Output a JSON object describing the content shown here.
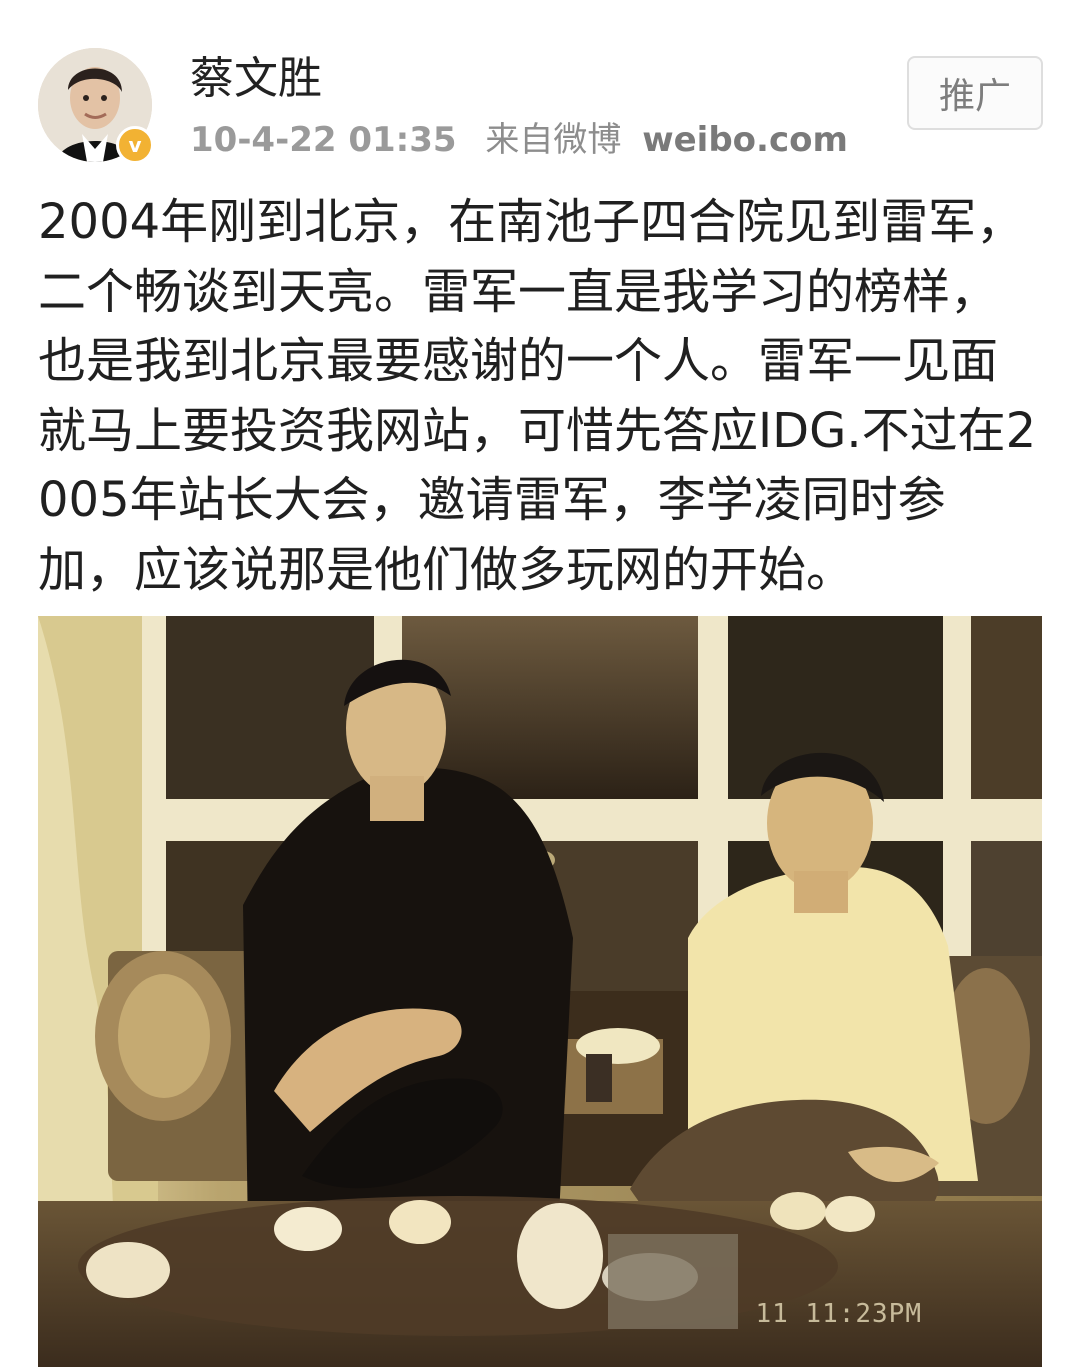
{
  "post": {
    "author": "蔡文胜",
    "timestamp": "10-4-22 01:35",
    "source_label": "来自微博",
    "source_domain": "weibo.com",
    "promote_label": "推广",
    "text": "2004年刚到北京，在南池子四合院见到雷军，二个畅谈到天亮。雷军一直是我学习的榜样，也是我到北京最要感谢的一个人。雷军一见面就马上要投资我网站，可惜先答应IDG.不过在2005年站长大会，邀请雷军，李学凌同时参加，应该说那是他们做多玩网的开始。"
  },
  "avatar": {
    "badge": "v",
    "badge_color": "#f2b233"
  },
  "photo": {
    "timestamp_text": "11 11:23PM"
  },
  "icons": {
    "verified": "verified-badge-icon"
  }
}
